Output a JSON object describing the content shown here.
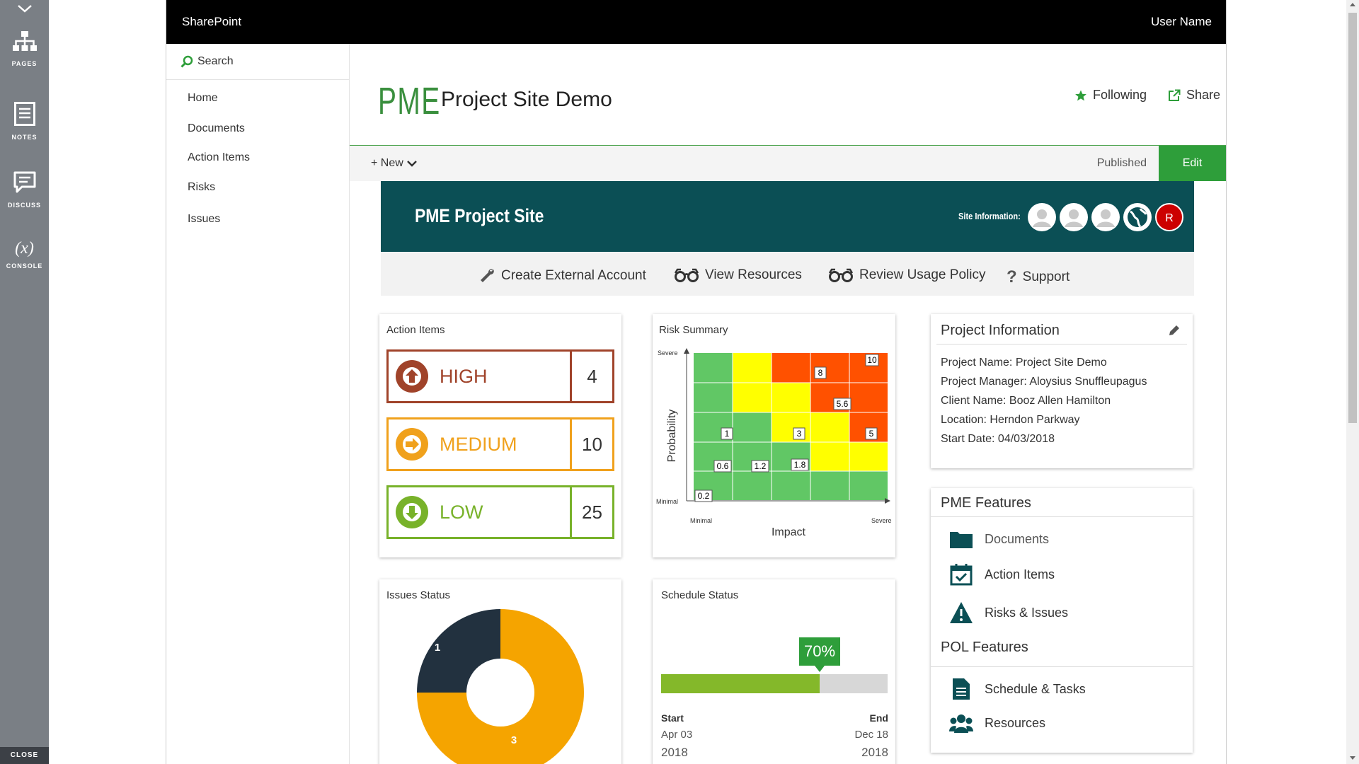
{
  "rail": {
    "items": [
      {
        "label": "PAGES",
        "icon": "sitemap-icon"
      },
      {
        "label": "NOTES",
        "icon": "notes-icon"
      },
      {
        "label": "DISCUSS",
        "icon": "discuss-icon"
      },
      {
        "label": "CONSOLE",
        "icon": "console-icon",
        "glyph": "(x)"
      }
    ],
    "close_label": "CLOSE"
  },
  "topbar": {
    "brand": "SharePoint",
    "user": "User Name"
  },
  "leftnav": {
    "search_label": "Search",
    "items": [
      "Home",
      "Documents",
      "Action Items",
      "Risks",
      "Issues"
    ]
  },
  "header": {
    "logo_text": "PME",
    "site_title": "Project Site Demo",
    "following_label": "Following",
    "share_label": "Share"
  },
  "cmdbar": {
    "new_label": "+ New",
    "published_label": "Published",
    "edit_label": "Edit"
  },
  "banner": {
    "title": "PME Project Site",
    "site_info_label": "Site Information:",
    "avatar_initial": "R"
  },
  "quicklinks": [
    "Create External Account",
    "View Resources",
    "Review Usage Policy",
    "Support"
  ],
  "action_items": {
    "title": "Action Items",
    "rows": [
      {
        "name": "HIGH",
        "count": "4",
        "color": "#a0432a"
      },
      {
        "name": "MEDIUM",
        "count": "10",
        "color": "#f0a11c"
      },
      {
        "name": "LOW",
        "count": "25",
        "color": "#78b22a"
      }
    ]
  },
  "risk_summary": {
    "title": "Risk Summary",
    "y_axis": "Probability",
    "x_axis": "Impact",
    "y_high": "Severe",
    "y_low": "Minimal",
    "x_low": "Minimal",
    "x_high": "Severe",
    "labels": [
      "10",
      "8",
      "5.6",
      "1",
      "3",
      "5",
      "0.6",
      "1.2",
      "1.8",
      "0.2"
    ]
  },
  "project_info": {
    "title": "Project Information",
    "lines": [
      "Project Name: Project Site Demo",
      "Project Manager: Aloysius Snuffleupagus",
      "Client Name: Booz Allen Hamilton",
      "Location: Herndon Parkway",
      "Start Date: 04/03/2018"
    ]
  },
  "features": {
    "pme_title": "PME Features",
    "pme_items": [
      "Documents",
      "Action Items",
      "Risks & Issues"
    ],
    "pol_title": "POL Features",
    "pol_items": [
      "Schedule & Tasks",
      "Resources"
    ]
  },
  "issues_status": {
    "title": "Issues Status",
    "values": [
      1,
      3
    ],
    "value_labels": [
      "1",
      "3"
    ],
    "colors": [
      "#22313f",
      "#f5a400"
    ]
  },
  "schedule_status": {
    "title": "Schedule Status",
    "percent": 70,
    "percent_label": "70%",
    "start_label": "Start",
    "end_label": "End",
    "start_date": "Apr 03",
    "start_year": "2018",
    "end_date": "Dec 18",
    "end_year": "2018"
  },
  "colors": {
    "accent_green": "#2e9e3a",
    "banner": "#0b4f55",
    "teal_icon": "#0b4f55"
  }
}
